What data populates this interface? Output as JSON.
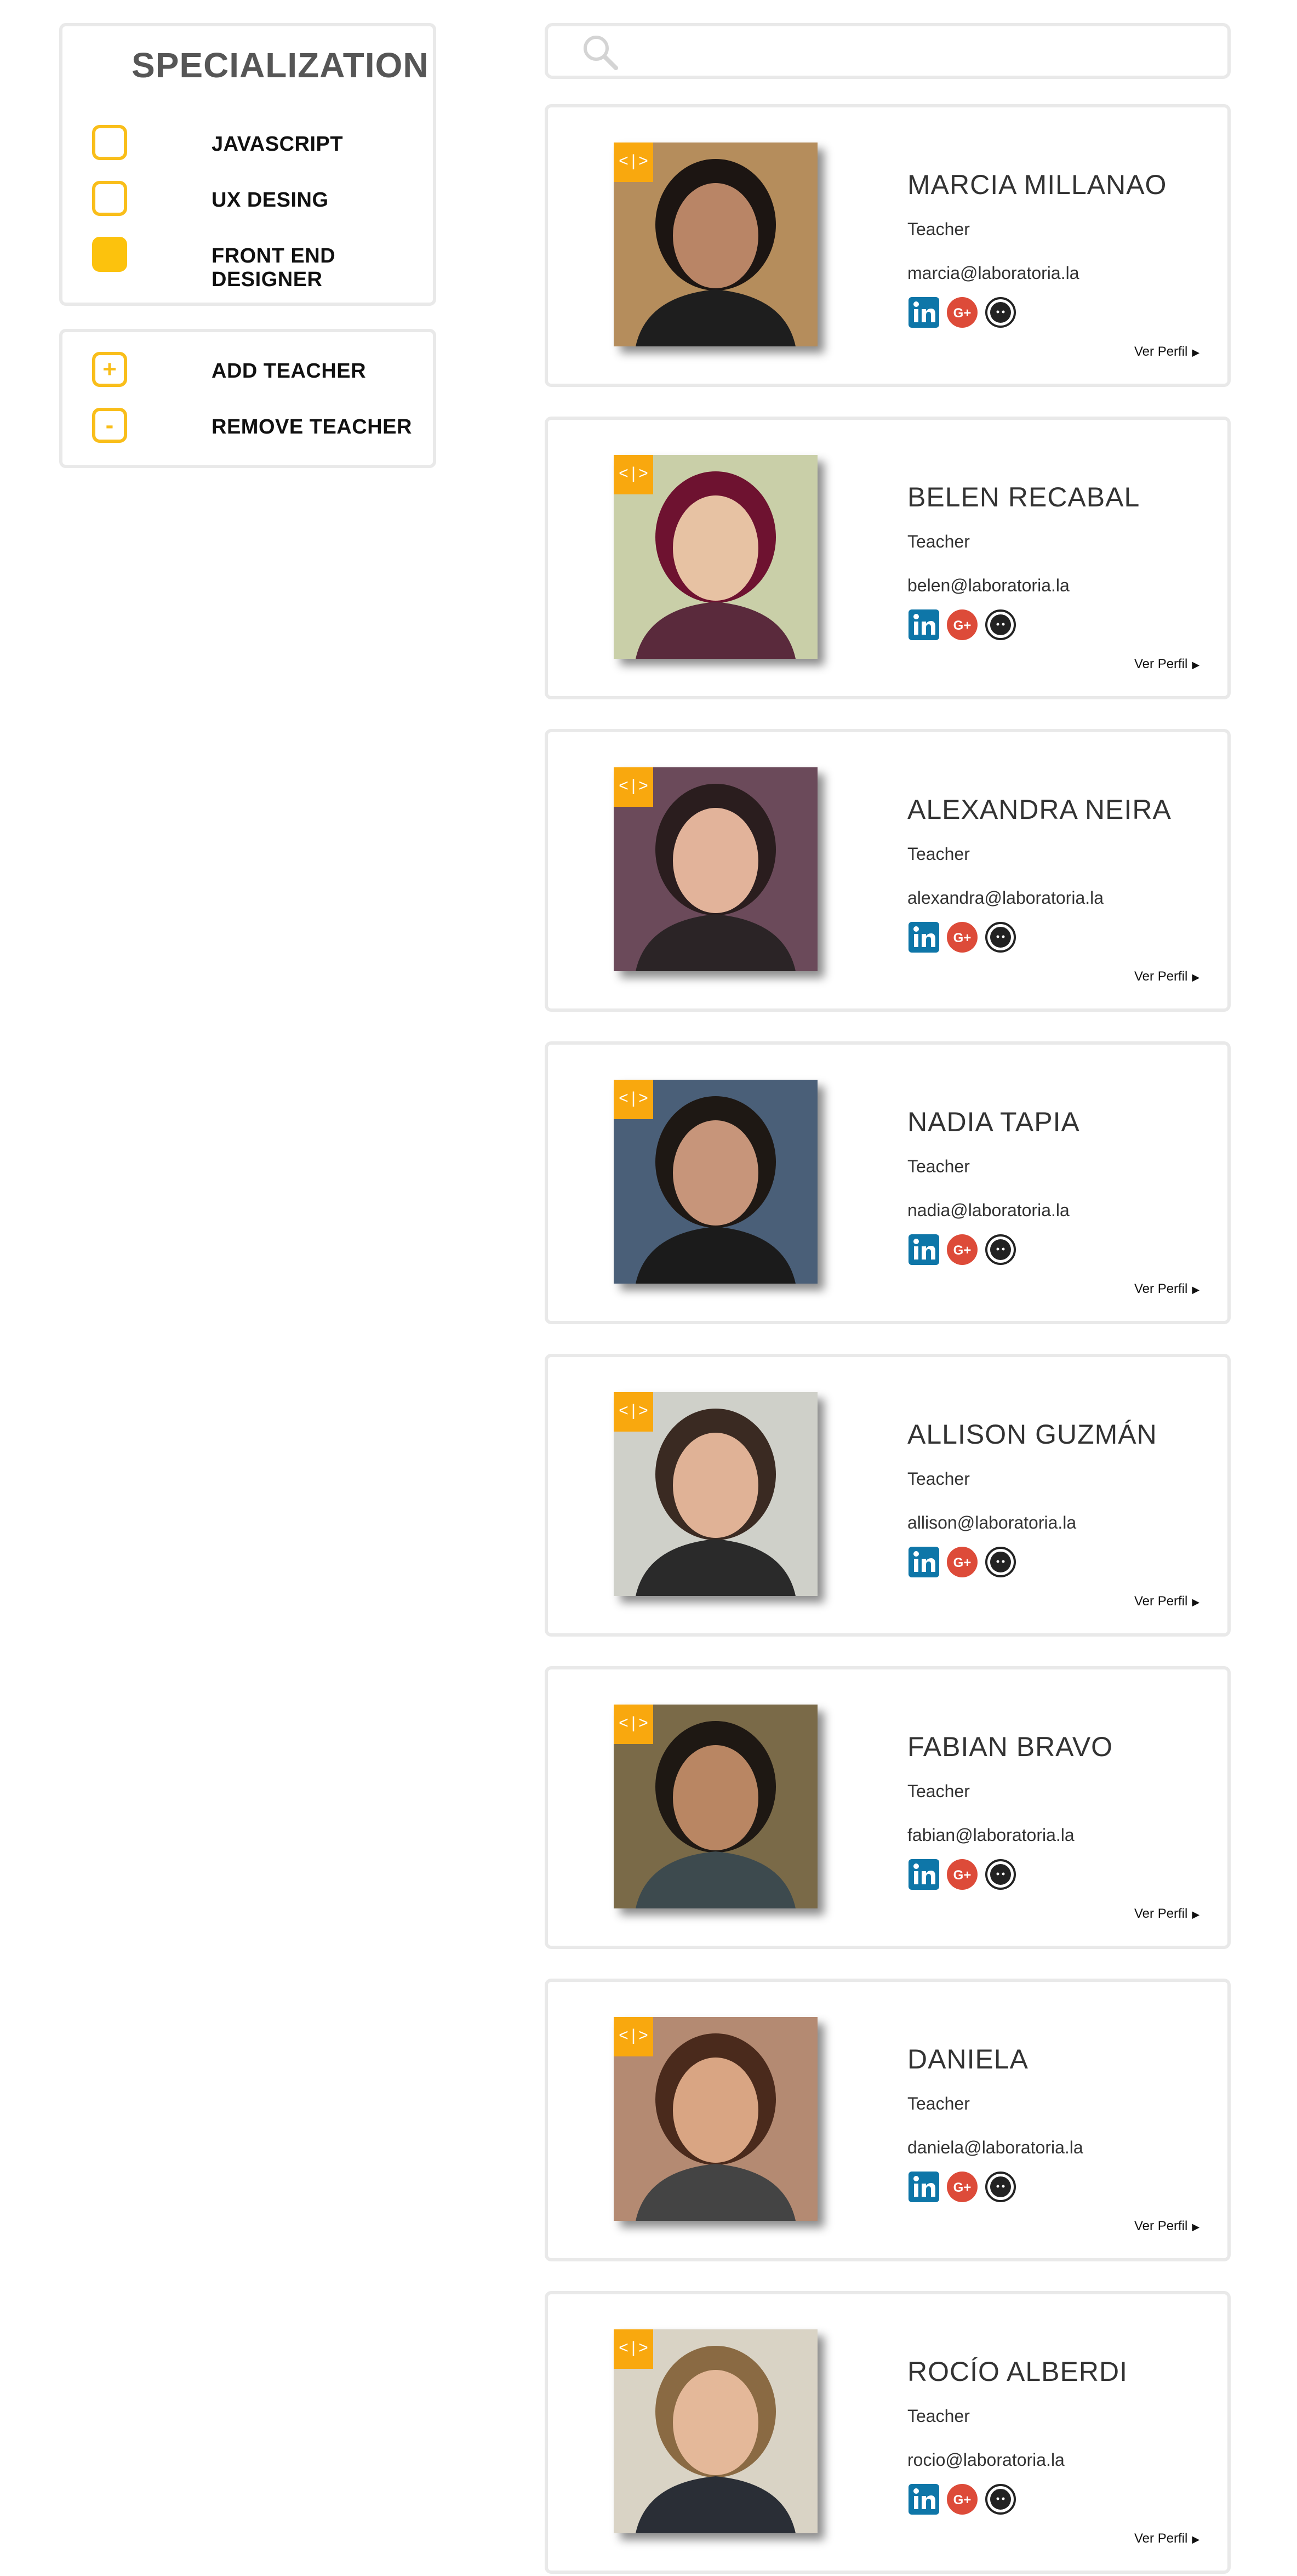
{
  "specialization": {
    "title": "SPECIALIZATION",
    "options": [
      {
        "label": "JAVASCRIPT",
        "checked": false
      },
      {
        "label": "UX DESING",
        "checked": false
      },
      {
        "label": "FRONT END DESIGNER",
        "checked": true
      }
    ]
  },
  "actions": {
    "add_label": "ADD TEACHER",
    "add_symbol": "+",
    "remove_label": "REMOVE TEACHER",
    "remove_symbol": "-"
  },
  "search": {
    "placeholder": "",
    "value": ""
  },
  "colors": {
    "accent": "#fcc20d",
    "badge": "#f9a80e",
    "linkedin": "#0e76a8",
    "google_plus": "#dd4b39",
    "github": "#222222"
  },
  "teachers": [
    {
      "name": "MARCIA MILLANAO",
      "role": "Teacher",
      "email": "marcia@laboratoria.la",
      "badge": "<|>",
      "profile_link": "Ver Perfil"
    },
    {
      "name": "BELEN RECABAL",
      "role": "Teacher",
      "email": "belen@laboratoria.la",
      "badge": "<|>",
      "profile_link": "Ver Perfil"
    },
    {
      "name": "ALEXANDRA NEIRA",
      "role": "Teacher",
      "email": "alexandra@laboratoria.la",
      "badge": "<|>",
      "profile_link": "Ver Perfil"
    },
    {
      "name": "NADIA TAPIA",
      "role": "Teacher",
      "email": "nadia@laboratoria.la",
      "badge": "<|>",
      "profile_link": "Ver Perfil"
    },
    {
      "name": "ALLISON GUZMÁN",
      "role": "Teacher",
      "email": "allison@laboratoria.la",
      "badge": "<|>",
      "profile_link": "Ver Perfil"
    },
    {
      "name": "FABIAN BRAVO",
      "role": "Teacher",
      "email": "fabian@laboratoria.la",
      "badge": "<|>",
      "profile_link": "Ver Perfil"
    },
    {
      "name": "DANIELA",
      "role": "Teacher",
      "email": "daniela@laboratoria.la",
      "badge": "<|>",
      "profile_link": "Ver Perfil"
    },
    {
      "name": "ROCÍO ALBERDI",
      "role": "Teacher",
      "email": "rocio@laboratoria.la",
      "badge": "<|>",
      "profile_link": "Ver Perfil"
    }
  ],
  "icons": {
    "search": "search-icon",
    "social": [
      "linkedin-icon",
      "google-plus-icon",
      "github-icon"
    ]
  }
}
